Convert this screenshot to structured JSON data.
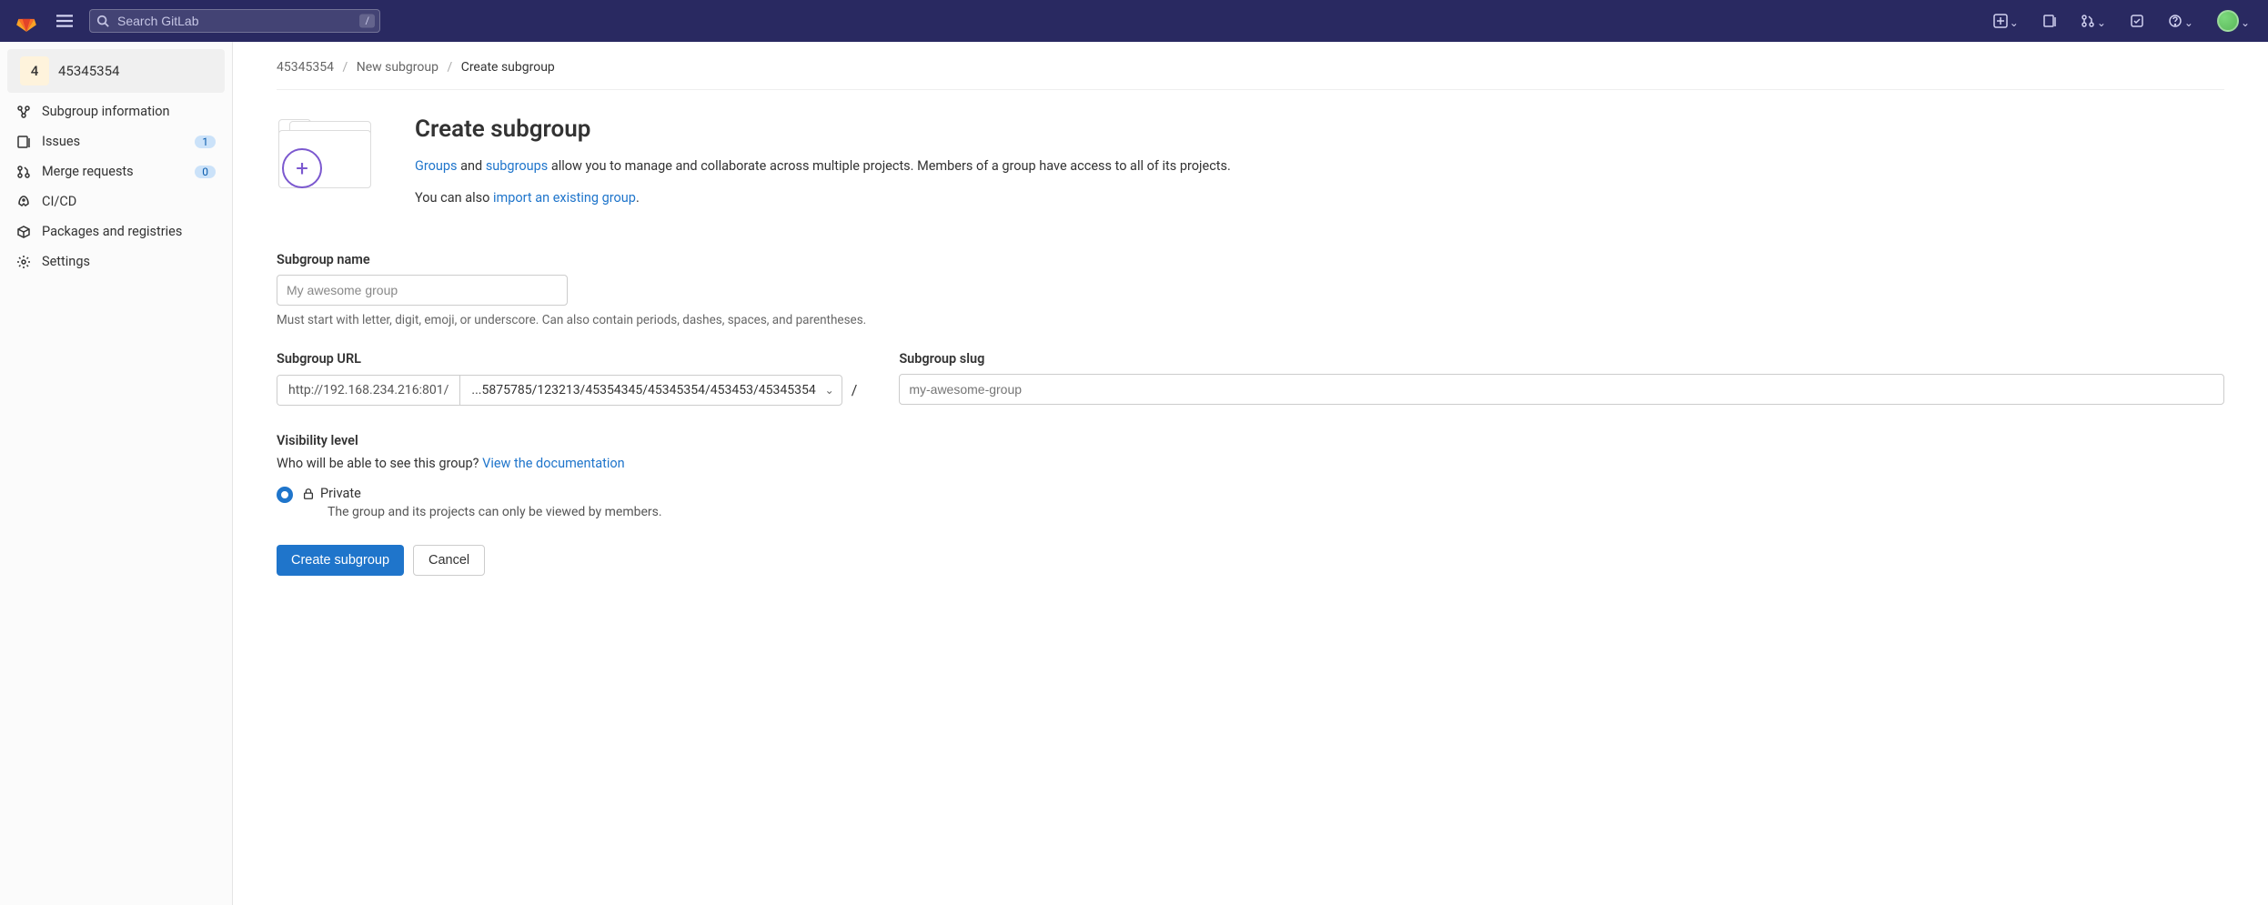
{
  "topnav": {
    "search_placeholder": "Search GitLab",
    "slash_hint": "/"
  },
  "sidebar": {
    "group_badge": "4",
    "group_title": "45345354",
    "items": [
      {
        "label": "Subgroup information",
        "icon": "info"
      },
      {
        "label": "Issues",
        "icon": "issues",
        "badge": "1"
      },
      {
        "label": "Merge requests",
        "icon": "merge",
        "badge": "0"
      },
      {
        "label": "CI/CD",
        "icon": "rocket"
      },
      {
        "label": "Packages and registries",
        "icon": "package"
      },
      {
        "label": "Settings",
        "icon": "gear"
      }
    ]
  },
  "breadcrumb": {
    "p0": "45345354",
    "p1": "New subgroup",
    "p2": "Create subgroup"
  },
  "header": {
    "title": "Create subgroup",
    "line1_a": "Groups",
    "line1_b": " and ",
    "line1_c": "subgroups",
    "line1_d": " allow you to manage and collaborate across multiple projects. Members of a group have access to all of its projects.",
    "line2_a": "You can also ",
    "line2_b": "import an existing group",
    "line2_c": "."
  },
  "form": {
    "name_label": "Subgroup name",
    "name_placeholder": "My awesome group",
    "name_help": "Must start with letter, digit, emoji, or underscore. Can also contain periods, dashes, spaces, and parentheses.",
    "url_label": "Subgroup URL",
    "url_prefix": "http://192.168.234.216:801/",
    "url_path": "...5875785/123213/45354345/45345354/453453/45345354",
    "slug_label": "Subgroup slug",
    "slug_placeholder": "my-awesome-group"
  },
  "visibility": {
    "label": "Visibility level",
    "desc_a": "Who will be able to see this group? ",
    "desc_link": "View the documentation",
    "option_label": "Private",
    "option_sub": "The group and its projects can only be viewed by members."
  },
  "buttons": {
    "primary": "Create subgroup",
    "secondary": "Cancel"
  }
}
